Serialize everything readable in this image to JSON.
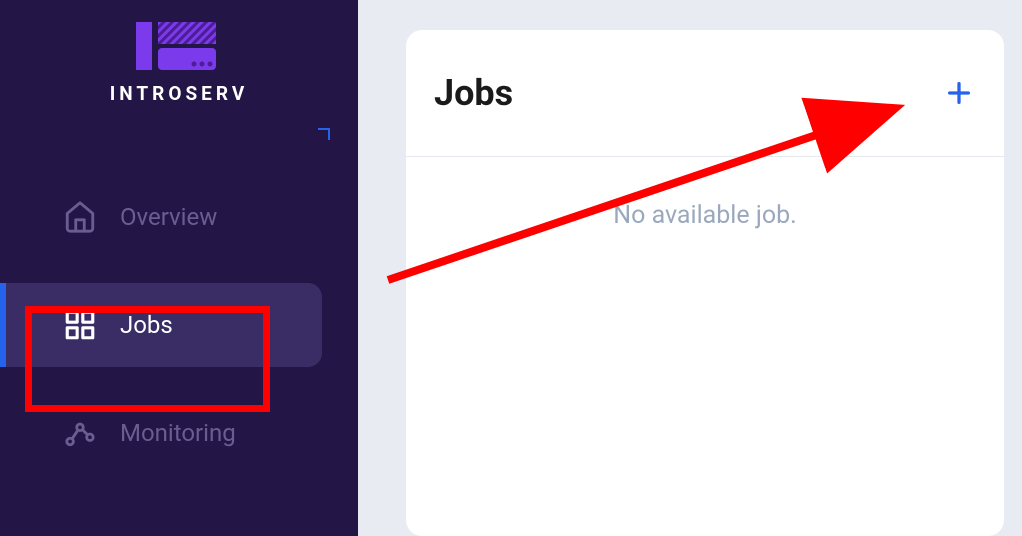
{
  "brand": {
    "name": "INTROSERV"
  },
  "sidebar": {
    "items": [
      {
        "label": "Overview",
        "active": false
      },
      {
        "label": "Jobs",
        "active": true
      },
      {
        "label": "Monitoring",
        "active": false
      }
    ]
  },
  "main": {
    "card_title": "Jobs",
    "empty_state": "No available job."
  },
  "colors": {
    "accent": "#2563eb",
    "highlight": "#fe0000"
  }
}
